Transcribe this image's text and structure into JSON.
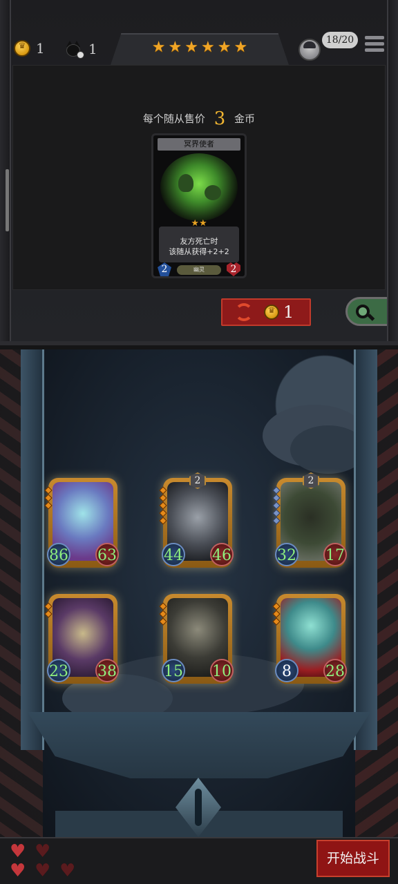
{
  "top_bar": {
    "gold": "1",
    "cat_count": "1",
    "stars": [
      "★",
      "★",
      "★",
      "★",
      "★",
      "★"
    ],
    "population": "18/20"
  },
  "shop": {
    "sell_prefix": "每个随从售价",
    "sell_price": "3",
    "sell_suffix": "金币",
    "card": {
      "name": "冥界使者",
      "stars": "★★",
      "desc_line1": "友方死亡时",
      "desc_line2": "该随从获得+2+2",
      "tribe": "幽灵",
      "atk": "2",
      "hp": "2"
    },
    "refresh_cost": "1"
  },
  "board": {
    "units": [
      {
        "name": "ghost-maw",
        "atk": "86",
        "hp": "63",
        "tier": "",
        "atk_buffed": true,
        "hp_buffed": true
      },
      {
        "name": "skeleton-mage",
        "atk": "44",
        "hp": "46",
        "tier": "2",
        "atk_buffed": true,
        "hp_buffed": true
      },
      {
        "name": "shadow-brute",
        "atk": "32",
        "hp": "17",
        "tier": "2",
        "atk_buffed": true,
        "hp_buffed": true
      },
      {
        "name": "reaper-skeleton",
        "atk": "23",
        "hp": "38",
        "tier": "",
        "atk_buffed": true,
        "hp_buffed": true
      },
      {
        "name": "hooded-necromancer",
        "atk": "15",
        "hp": "10",
        "tier": "",
        "atk_buffed": true,
        "hp_buffed": true
      },
      {
        "name": "spectral-summoner",
        "atk": "8",
        "hp": "28",
        "tier": "",
        "atk_buffed": false,
        "hp_buffed": true
      }
    ]
  },
  "footer": {
    "hearts": 5,
    "hearts_full": 2,
    "start_label": "开始战斗"
  },
  "colors": {
    "gold": "#f1b531",
    "buff_green": "#8ff07e",
    "button_red": "#8f1414",
    "heart_red": "#c4373c"
  }
}
